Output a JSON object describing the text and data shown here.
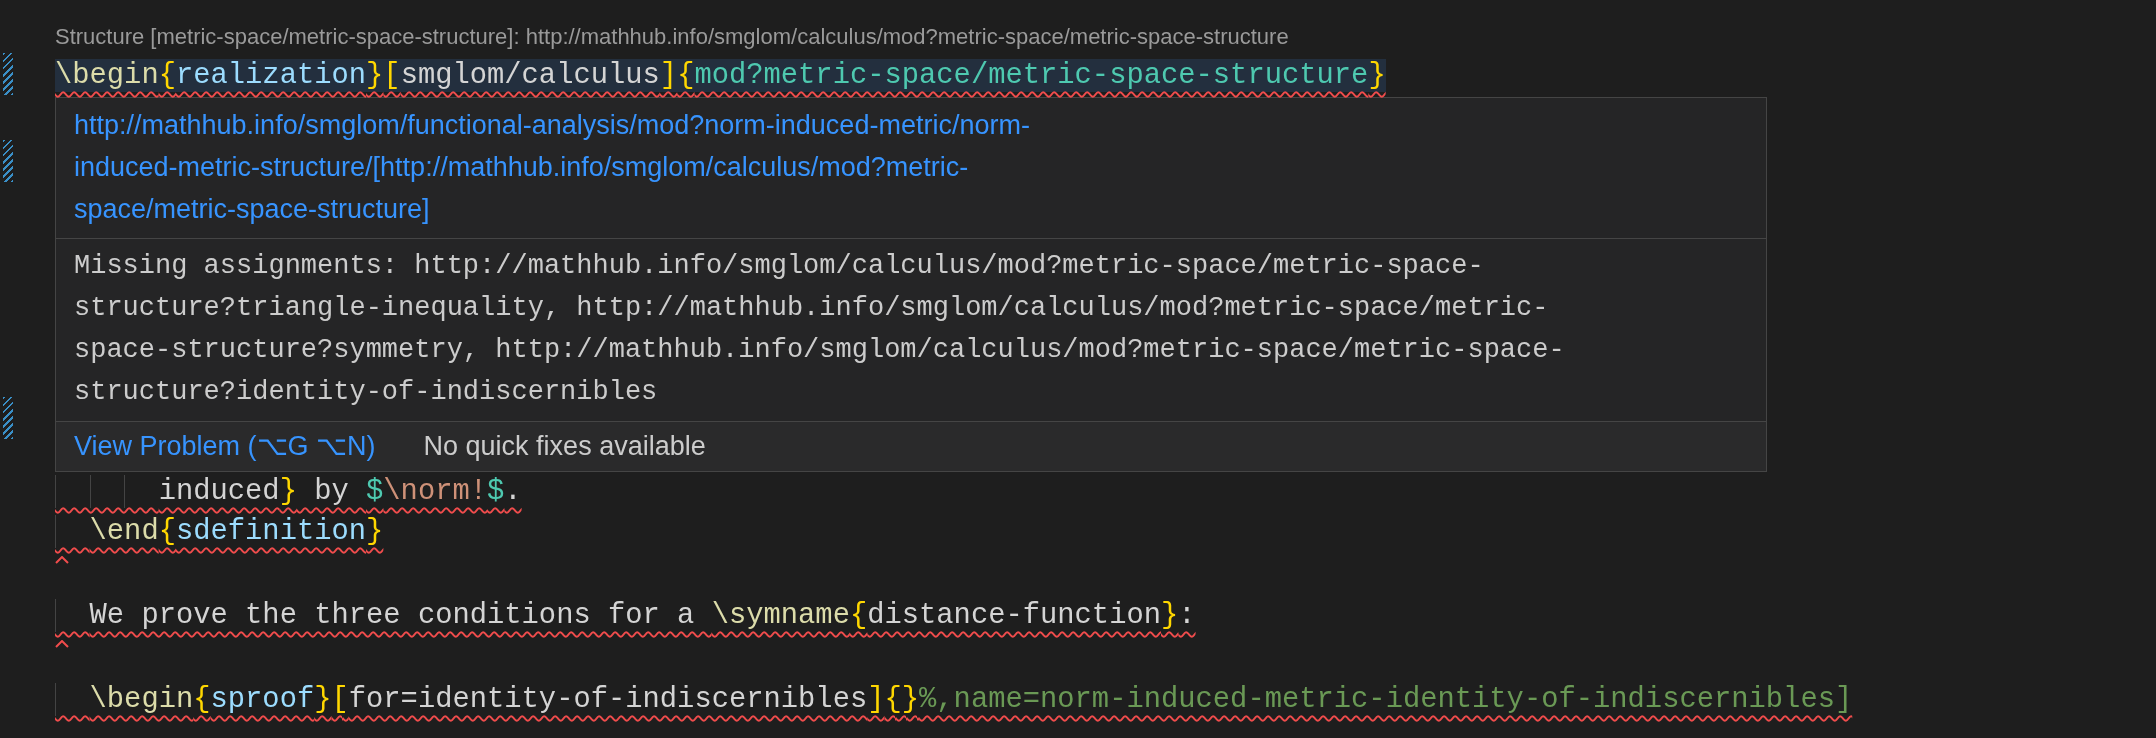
{
  "editor": {
    "codelens": "Structure [metric-space/metric-space-structure]: http://mathhub.info/smglom/calculus/mod?metric-space/metric-space-structure",
    "lines": [
      {
        "error": true,
        "highlighted": true,
        "tokens": [
          {
            "kind": "command",
            "text": "\\begin"
          },
          {
            "kind": "brace",
            "text": "{"
          },
          {
            "kind": "env",
            "text": "realization"
          },
          {
            "kind": "brace",
            "text": "}"
          },
          {
            "kind": "brace",
            "text": "["
          },
          {
            "kind": "text",
            "text": "smglom/calculus"
          },
          {
            "kind": "brace",
            "text": "]"
          },
          {
            "kind": "brace",
            "text": "{"
          },
          {
            "kind": "module",
            "text": "mod?metric-space/metric-space-structure"
          },
          {
            "kind": "brace",
            "text": "}"
          }
        ]
      },
      {
        "error": true,
        "highlighted": false,
        "tokens": [
          {
            "kind": "text",
            "text": "      induced"
          },
          {
            "kind": "brace",
            "text": "}"
          },
          {
            "kind": "text",
            "text": " by "
          },
          {
            "kind": "math",
            "text": "$"
          },
          {
            "kind": "mathcmd",
            "text": "\\norm!"
          },
          {
            "kind": "math",
            "text": "$"
          },
          {
            "kind": "text",
            "text": "."
          }
        ]
      },
      {
        "error": true,
        "highlighted": false,
        "tokens": [
          {
            "kind": "command",
            "text": "  \\end"
          },
          {
            "kind": "brace",
            "text": "{"
          },
          {
            "kind": "env",
            "text": "sdefinition"
          },
          {
            "kind": "brace",
            "text": "}"
          }
        ]
      },
      {
        "error": true
      },
      {
        "error": true,
        "highlighted": false,
        "tokens": [
          {
            "kind": "text",
            "text": "  We prove the three conditions for a "
          },
          {
            "kind": "command",
            "text": "\\symname"
          },
          {
            "kind": "brace",
            "text": "{"
          },
          {
            "kind": "text",
            "text": "distance-function"
          },
          {
            "kind": "brace",
            "text": "}"
          },
          {
            "kind": "text",
            "text": ":"
          }
        ]
      },
      {
        "error": true
      },
      {
        "error": true,
        "highlighted": false,
        "tokens": [
          {
            "kind": "command",
            "text": "  \\begin"
          },
          {
            "kind": "brace",
            "text": "{"
          },
          {
            "kind": "env",
            "text": "sproof"
          },
          {
            "kind": "brace",
            "text": "}"
          },
          {
            "kind": "brace",
            "text": "["
          },
          {
            "kind": "text",
            "text": "for=identity-of-indiscernibles"
          },
          {
            "kind": "brace",
            "text": "]"
          },
          {
            "kind": "brace",
            "text": "{}"
          },
          {
            "kind": "comment",
            "text": "%,name=norm-induced-metric-identity-of-indiscernibles]"
          }
        ]
      }
    ]
  },
  "hover": {
    "link": "http://mathhub.info/smglom/functional-analysis/mod?norm-induced-metric/norm-\ninduced-metric-structure/[http://mathhub.info/smglom/calculus/mod?metric-\nspace/metric-space-structure]",
    "message": "Missing assignments: http://mathhub.info/smglom/calculus/mod?metric-space/metric-space-\nstructure?triangle-inequality, http://mathhub.info/smglom/calculus/mod?metric-space/metric-\nspace-structure?symmetry, http://mathhub.info/smglom/calculus/mod?metric-space/metric-space-\nstructure?identity-of-indiscernibles",
    "action": "View Problem (⌥G ⌥N)",
    "note": "No quick fixes available"
  }
}
